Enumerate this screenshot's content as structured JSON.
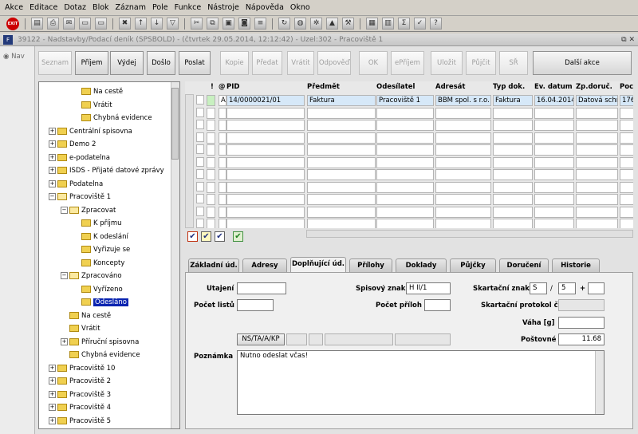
{
  "menu": [
    "Akce",
    "Editace",
    "Dotaz",
    "Blok",
    "Záznam",
    "Pole",
    "Funkce",
    "Nástroje",
    "Nápověda",
    "Okno"
  ],
  "toolbar": {
    "exit_label": "EXIT",
    "icons": [
      "save-icon",
      "print-icon",
      "mail-icon",
      "document-icon",
      "document-red-icon",
      "delete-icon",
      "sort-asc-icon",
      "sort-desc-icon",
      "filter-icon",
      "cut-icon",
      "copy-icon",
      "paste-icon",
      "camera-icon",
      "list-icon",
      "refresh-icon",
      "globe-icon",
      "settings-icon",
      "warning-icon",
      "tools-icon",
      "calculator-icon",
      "chart-icon",
      "sum-icon",
      "check-icon",
      "help-icon"
    ]
  },
  "window": {
    "title": "39122 - Nadstavby/Podací deník (SPSBOLD) - (čtvrtek 29.05.2014, 12:12:42) - Uzel:302 - Pracoviště 1",
    "icon": "F",
    "controls": "⧉ ✕"
  },
  "nav": {
    "label": "Nav"
  },
  "actions": [
    {
      "label": "Seznam",
      "enabled": false
    },
    {
      "label": "Příjem",
      "enabled": true
    },
    {
      "label": "Výdej",
      "enabled": true
    },
    {
      "label": "Došlo",
      "enabled": true
    },
    {
      "label": "Poslat",
      "enabled": true
    },
    {
      "label": "Kopie",
      "enabled": false
    },
    {
      "label": "Předat",
      "enabled": false
    },
    {
      "label": "Vrátit",
      "enabled": false
    },
    {
      "label": "Odpověď",
      "enabled": false
    },
    {
      "label": "OK",
      "enabled": false
    },
    {
      "label": "ePříjem",
      "enabled": false
    },
    {
      "label": "Uložit",
      "enabled": false
    },
    {
      "label": "Půjčit",
      "enabled": false
    },
    {
      "label": "SŘ",
      "enabled": false
    },
    {
      "label": "Další akce",
      "enabled": true
    }
  ],
  "tree": [
    {
      "label": "Na cestě",
      "level": 2,
      "exp": ""
    },
    {
      "label": "Vrátit",
      "level": 2,
      "exp": ""
    },
    {
      "label": "Chybná evidence",
      "level": 2,
      "exp": ""
    },
    {
      "label": "Centrální spisovna",
      "level": 0,
      "exp": "+"
    },
    {
      "label": "Demo 2",
      "level": 0,
      "exp": "+"
    },
    {
      "label": "e-podatelna",
      "level": 0,
      "exp": "+"
    },
    {
      "label": "ISDS - Přijaté datové zprávy",
      "level": 0,
      "exp": "+"
    },
    {
      "label": "Podatelna",
      "level": 0,
      "exp": "+"
    },
    {
      "label": "Pracoviště 1",
      "level": 0,
      "exp": "−",
      "open": true
    },
    {
      "label": "Zpracovat",
      "level": 1,
      "exp": "−",
      "open": true
    },
    {
      "label": "K příjmu",
      "level": 2,
      "exp": ""
    },
    {
      "label": "K odeslání",
      "level": 2,
      "exp": ""
    },
    {
      "label": "Vyřizuje se",
      "level": 2,
      "exp": ""
    },
    {
      "label": "Koncepty",
      "level": 2,
      "exp": ""
    },
    {
      "label": "Zpracováno",
      "level": 1,
      "exp": "−",
      "open": true
    },
    {
      "label": "Vyřízeno",
      "level": 2,
      "exp": ""
    },
    {
      "label": "Odesláno",
      "level": 2,
      "exp": "",
      "selected": true
    },
    {
      "label": "Na cestě",
      "level": 1,
      "exp": ""
    },
    {
      "label": "Vrátit",
      "level": 1,
      "exp": ""
    },
    {
      "label": "Příruční spisovna",
      "level": 1,
      "exp": "+"
    },
    {
      "label": "Chybná evidence",
      "level": 1,
      "exp": ""
    },
    {
      "label": "Pracoviště 10",
      "level": 0,
      "exp": "+"
    },
    {
      "label": "Pracoviště 2",
      "level": 0,
      "exp": "+"
    },
    {
      "label": "Pracoviště 3",
      "level": 0,
      "exp": "+"
    },
    {
      "label": "Pracoviště 4",
      "level": 0,
      "exp": "+"
    },
    {
      "label": "Pracoviště 5",
      "level": 0,
      "exp": "+"
    }
  ],
  "grid": {
    "headers": [
      "!",
      "@",
      "PID",
      "Předmět",
      "Odesílatel",
      "Adresát",
      "Typ dok.",
      "Ev. datum",
      "Zp.doruč.",
      "Poc"
    ],
    "row": [
      "A",
      "14/0000021/01",
      "Faktura",
      "Pracoviště 1",
      "BBM spol. s r.o.",
      "Faktura",
      "16.04.2014",
      "Datová schrá",
      "176"
    ],
    "empty_rows": 10
  },
  "tabs": [
    "Základní úd.",
    "Adresy",
    "Doplňující úd.",
    "Přílohy",
    "Doklady",
    "Půjčky",
    "Doručení",
    "Historie"
  ],
  "active_tab": 2,
  "form": {
    "utajeni_label": "Utajení",
    "utajeni_value": "",
    "pocet_listu_label": "Počet listů",
    "pocet_listu_value": "",
    "spisovy_znak_label": "Spisový znak",
    "spisovy_znak_value": "H II/1",
    "pocet_priloh_label": "Počet příloh",
    "pocet_priloh_value": "",
    "skartacni_znak_label": "Skartační znak",
    "skartacni_znak_value": "S",
    "skartacni_slash": "/",
    "skartacni_lhuta": "5",
    "skartacni_plus": "+",
    "skartacni_extra": "",
    "skartacni_protokol_label": "Skartační protokol č.",
    "vaha_label": "Váha [g]",
    "vaha_value": "",
    "postovne_label": "Poštovné",
    "postovne_value": "11.68",
    "ns_button": "NS/TA/A/KP",
    "poznamka_label": "Poznámka",
    "poznamka_value": "Nutno odeslat včas!"
  }
}
